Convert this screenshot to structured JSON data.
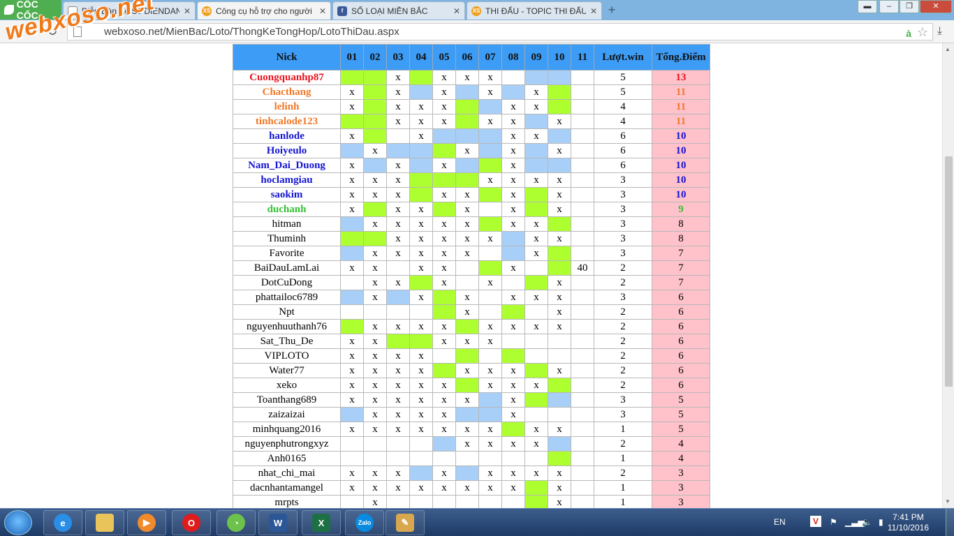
{
  "browser": {
    "brand": "CỐC CỐC",
    "tabs": [
      {
        "title": "Diễn Đàn Xổ Số DIENDAN",
        "icon": "document-icon"
      },
      {
        "title": "Công cụ hỗ trợ cho người",
        "icon": "xs-icon",
        "active": true
      },
      {
        "title": "SỐ LOẠI MIỀN BẮC",
        "icon": "facebook-icon"
      },
      {
        "title": "THI ĐẤU - TOPIC THI ĐẤU",
        "icon": "xs-icon"
      }
    ],
    "url": "webxoso.net/MienBac/Loto/ThongKeTongHop/LotoThiDau.aspx",
    "watermark": "webxoso.net"
  },
  "table": {
    "headers": {
      "nick": "Nick",
      "cols": [
        "01",
        "02",
        "03",
        "04",
        "05",
        "06",
        "07",
        "08",
        "09",
        "10",
        "11"
      ],
      "luot_win": "Lượt.win",
      "tong_diem": "Tổng.Điểm"
    },
    "rows": [
      {
        "nick": "Cuongquanhp87",
        "style": "red",
        "cells": [
          "g",
          "g",
          "x",
          "g",
          "x",
          "x",
          "x",
          "",
          "b",
          "b",
          ""
        ],
        "win": "5",
        "total": "13"
      },
      {
        "nick": "Chacthang",
        "style": "orange",
        "cells": [
          "x",
          "g",
          "x",
          "b",
          "x",
          "b",
          "x",
          "b",
          "x",
          "g",
          ""
        ],
        "win": "5",
        "total": "11"
      },
      {
        "nick": "lelinh",
        "style": "orange",
        "cells": [
          "x",
          "g",
          "x",
          "x",
          "x",
          "g",
          "b",
          "x",
          "x",
          "g",
          ""
        ],
        "win": "4",
        "total": "11"
      },
      {
        "nick": "tinhcalode123",
        "style": "orange",
        "cells": [
          "g",
          "g",
          "x",
          "x",
          "x",
          "g",
          "x",
          "x",
          "b",
          "x",
          ""
        ],
        "win": "4",
        "total": "11"
      },
      {
        "nick": "hanlode",
        "style": "blue",
        "cells": [
          "x",
          "g",
          "",
          "x",
          "b",
          "b",
          "b",
          "x",
          "x",
          "b",
          ""
        ],
        "win": "6",
        "total": "10"
      },
      {
        "nick": "Hoiyeulo",
        "style": "blue",
        "cells": [
          "b",
          "x",
          "b",
          "b",
          "g",
          "x",
          "b",
          "x",
          "b",
          "x",
          ""
        ],
        "win": "6",
        "total": "10"
      },
      {
        "nick": "Nam_Dai_Duong",
        "style": "blue",
        "cells": [
          "x",
          "b",
          "x",
          "b",
          "x",
          "b",
          "g",
          "x",
          "b",
          "b",
          ""
        ],
        "win": "6",
        "total": "10"
      },
      {
        "nick": "hoclamgiau",
        "style": "blue",
        "cells": [
          "x",
          "x",
          "x",
          "g",
          "g",
          "g",
          "x",
          "x",
          "x",
          "x",
          ""
        ],
        "win": "3",
        "total": "10"
      },
      {
        "nick": "saokim",
        "style": "blue",
        "cells": [
          "x",
          "x",
          "x",
          "g",
          "x",
          "x",
          "g",
          "x",
          "g",
          "x",
          ""
        ],
        "win": "3",
        "total": "10"
      },
      {
        "nick": "duchanh",
        "style": "green",
        "cells": [
          "x",
          "g",
          "x",
          "x",
          "g",
          "x",
          "",
          "x",
          "g",
          "x",
          ""
        ],
        "win": "3",
        "total": "9"
      },
      {
        "nick": "hitman",
        "style": "",
        "cells": [
          "b",
          "x",
          "x",
          "x",
          "x",
          "x",
          "g",
          "x",
          "x",
          "g",
          ""
        ],
        "win": "3",
        "total": "8"
      },
      {
        "nick": "Thuminh",
        "style": "",
        "cells": [
          "g",
          "g",
          "x",
          "x",
          "x",
          "x",
          "x",
          "b",
          "x",
          "x",
          ""
        ],
        "win": "3",
        "total": "8"
      },
      {
        "nick": "Favorite",
        "style": "",
        "cells": [
          "b",
          "x",
          "x",
          "x",
          "x",
          "x",
          "",
          "b",
          "x",
          "g",
          ""
        ],
        "win": "3",
        "total": "7"
      },
      {
        "nick": "BaiDauLamLai",
        "style": "",
        "cells": [
          "x",
          "x",
          "",
          "x",
          "x",
          "",
          "g",
          "x",
          "",
          "g",
          "40"
        ],
        "win": "2",
        "total": "7"
      },
      {
        "nick": "DotCuDong",
        "style": "",
        "cells": [
          "",
          "x",
          "x",
          "g",
          "x",
          "",
          "x",
          "",
          "g",
          "x",
          ""
        ],
        "win": "2",
        "total": "7"
      },
      {
        "nick": "phattailoc6789",
        "style": "",
        "cells": [
          "b",
          "x",
          "b",
          "x",
          "g",
          "x",
          "",
          "x",
          "x",
          "x",
          ""
        ],
        "win": "3",
        "total": "6"
      },
      {
        "nick": "Npt",
        "style": "",
        "cells": [
          "",
          "",
          "",
          "",
          "g",
          "x",
          "",
          "g",
          "",
          "x",
          ""
        ],
        "win": "2",
        "total": "6"
      },
      {
        "nick": "nguyenhuuthanh76",
        "style": "",
        "cells": [
          "g",
          "x",
          "x",
          "x",
          "x",
          "g",
          "x",
          "x",
          "x",
          "x",
          ""
        ],
        "win": "2",
        "total": "6"
      },
      {
        "nick": "Sat_Thu_De",
        "style": "",
        "cells": [
          "x",
          "x",
          "g",
          "g",
          "x",
          "x",
          "x",
          "",
          "",
          "",
          ""
        ],
        "win": "2",
        "total": "6"
      },
      {
        "nick": "VIPLOTO",
        "style": "",
        "cells": [
          "x",
          "x",
          "x",
          "x",
          "",
          "g",
          "",
          "g",
          "",
          "",
          ""
        ],
        "win": "2",
        "total": "6"
      },
      {
        "nick": "Water77",
        "style": "",
        "cells": [
          "x",
          "x",
          "x",
          "x",
          "g",
          "x",
          "x",
          "x",
          "g",
          "x",
          ""
        ],
        "win": "2",
        "total": "6"
      },
      {
        "nick": "xeko",
        "style": "",
        "cells": [
          "x",
          "x",
          "x",
          "x",
          "x",
          "g",
          "x",
          "x",
          "x",
          "g",
          ""
        ],
        "win": "2",
        "total": "6"
      },
      {
        "nick": "Toanthang689",
        "style": "",
        "cells": [
          "x",
          "x",
          "x",
          "x",
          "x",
          "x",
          "b",
          "x",
          "g",
          "b",
          ""
        ],
        "win": "3",
        "total": "5"
      },
      {
        "nick": "zaizaizai",
        "style": "",
        "cells": [
          "b",
          "x",
          "x",
          "x",
          "x",
          "b",
          "b",
          "x",
          "",
          "",
          ""
        ],
        "win": "3",
        "total": "5"
      },
      {
        "nick": "minhquang2016",
        "style": "",
        "cells": [
          "x",
          "x",
          "x",
          "x",
          "x",
          "x",
          "x",
          "g",
          "x",
          "x",
          ""
        ],
        "win": "1",
        "total": "5"
      },
      {
        "nick": "nguyenphutrongxyz",
        "style": "",
        "cells": [
          "",
          "",
          "",
          "",
          "b",
          "x",
          "x",
          "x",
          "x",
          "b",
          ""
        ],
        "win": "2",
        "total": "4"
      },
      {
        "nick": "Anh0165",
        "style": "",
        "cells": [
          "",
          "",
          "",
          "",
          "",
          "",
          "",
          "",
          "",
          "g",
          ""
        ],
        "win": "1",
        "total": "4"
      },
      {
        "nick": "nhat_chi_mai",
        "style": "",
        "cells": [
          "x",
          "x",
          "x",
          "b",
          "x",
          "b",
          "x",
          "x",
          "x",
          "x",
          ""
        ],
        "win": "2",
        "total": "3"
      },
      {
        "nick": "dacnhantamangel",
        "style": "",
        "cells": [
          "x",
          "x",
          "x",
          "x",
          "x",
          "x",
          "x",
          "x",
          "g",
          "x",
          ""
        ],
        "win": "1",
        "total": "3"
      },
      {
        "nick": "mrpts",
        "style": "",
        "cells": [
          "",
          "x",
          "",
          "",
          "",
          "",
          "",
          "",
          "g",
          "x",
          ""
        ],
        "win": "1",
        "total": "3"
      }
    ]
  },
  "taskbar": {
    "apps": [
      "internet-explorer-icon",
      "file-explorer-icon",
      "media-player-icon",
      "opera-icon",
      "coccoc-icon",
      "word-icon",
      "excel-icon",
      "zalo-icon",
      "paint-icon"
    ],
    "language": "EN",
    "time": "7:41 PM",
    "date": "11/10/2016",
    "zalo_label": "Zalo",
    "word_label": "W",
    "excel_label": "X"
  },
  "colors": {
    "green_cell": "#adff2f",
    "blue_cell": "#a8cff7",
    "header": "#3d9cf5",
    "total_cell": "#ffc2cb"
  }
}
